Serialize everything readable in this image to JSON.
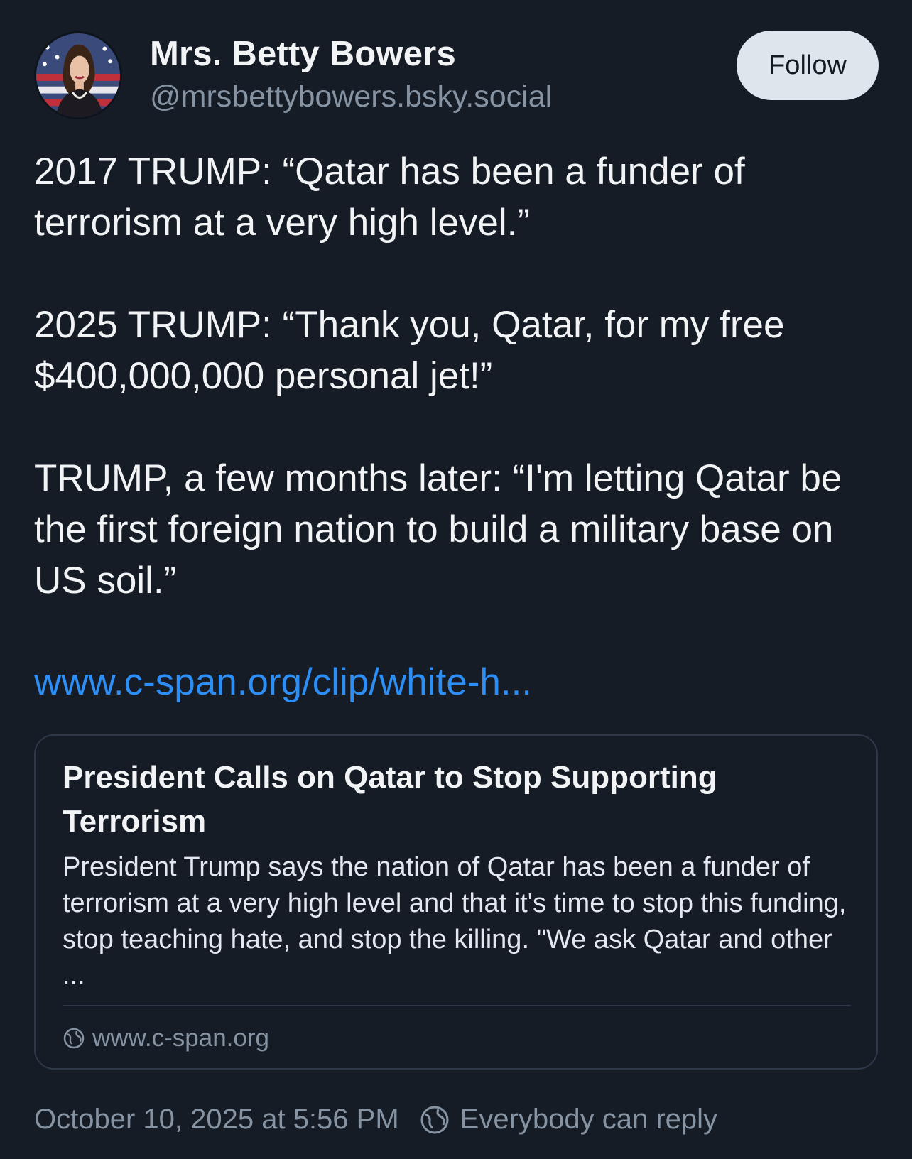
{
  "author": {
    "display_name": "Mrs. Betty Bowers",
    "handle": "@mrsbettybowers.bsky.social",
    "avatar_icon": "avatar"
  },
  "follow_button": {
    "label": "Follow"
  },
  "post": {
    "paragraphs": [
      "2017 TRUMP: “Qatar has been a funder of terrorism at a very high level.”",
      "2025 TRUMP: “Thank you, Qatar, for my free $400,000,000 personal jet!”",
      "TRUMP, a few months later: “I'm letting Qatar be the first foreign nation to build a military base on US soil.”"
    ],
    "link_text": "www.c-span.org/clip/white-h..."
  },
  "embed": {
    "title": "President Calls on Qatar to Stop Supporting Terrorism",
    "description": "President Trump says the nation of Qatar has been a funder of terrorism at a very high level and that it's time to stop this funding, stop teaching hate, and stop the killing. \"We ask Qatar and other ...",
    "domain": "www.c-span.org",
    "domain_icon": "globe-icon"
  },
  "footer": {
    "timestamp": "October 10, 2025 at 5:56 PM",
    "reply_setting": "Everybody can reply",
    "reply_icon": "globe-icon"
  },
  "colors": {
    "background": "#151c26",
    "link": "#2d8ef5",
    "muted_text": "#8693a3",
    "follow_button_bg": "#dfe5ed",
    "card_border": "#2d3848"
  }
}
